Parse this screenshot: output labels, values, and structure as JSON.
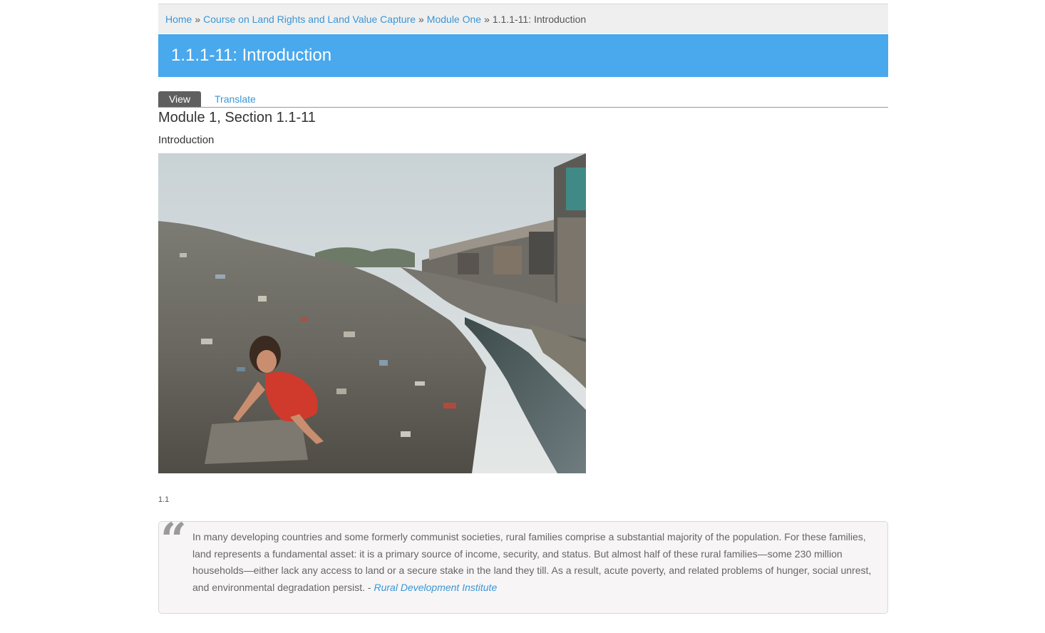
{
  "breadcrumb": {
    "items": [
      "Home",
      "Course on Land Rights and Land Value Capture",
      "Module One"
    ],
    "separator": "»",
    "current": "1.1.1-11: Introduction"
  },
  "page_title": "1.1.1-11: Introduction",
  "tabs": {
    "view": "View",
    "translate": "Translate"
  },
  "section_heading": "Module 1, Section 1.1-11",
  "subheading": "Introduction",
  "photo": {
    "alt": "photo"
  },
  "caption_number": "1.1",
  "quote": {
    "text": "In many developing countries and some formerly communist societies, rural families comprise a substantial majority of the population. For these families, land represents a fundamental asset: it is a primary source of income, security, and status. But almost half of these rural families—some 230 million households—either lack any access to land or a secure stake in the land they till. As a result, acute poverty, and related problems of hunger, social unrest, and environmental degradation persist. -",
    "source": "Rural Development Institute",
    "mark": "“"
  },
  "colors": {
    "link": "#3a96d6",
    "title_bar": "#4aa8ec",
    "active_tab": "#5f5f5f"
  }
}
